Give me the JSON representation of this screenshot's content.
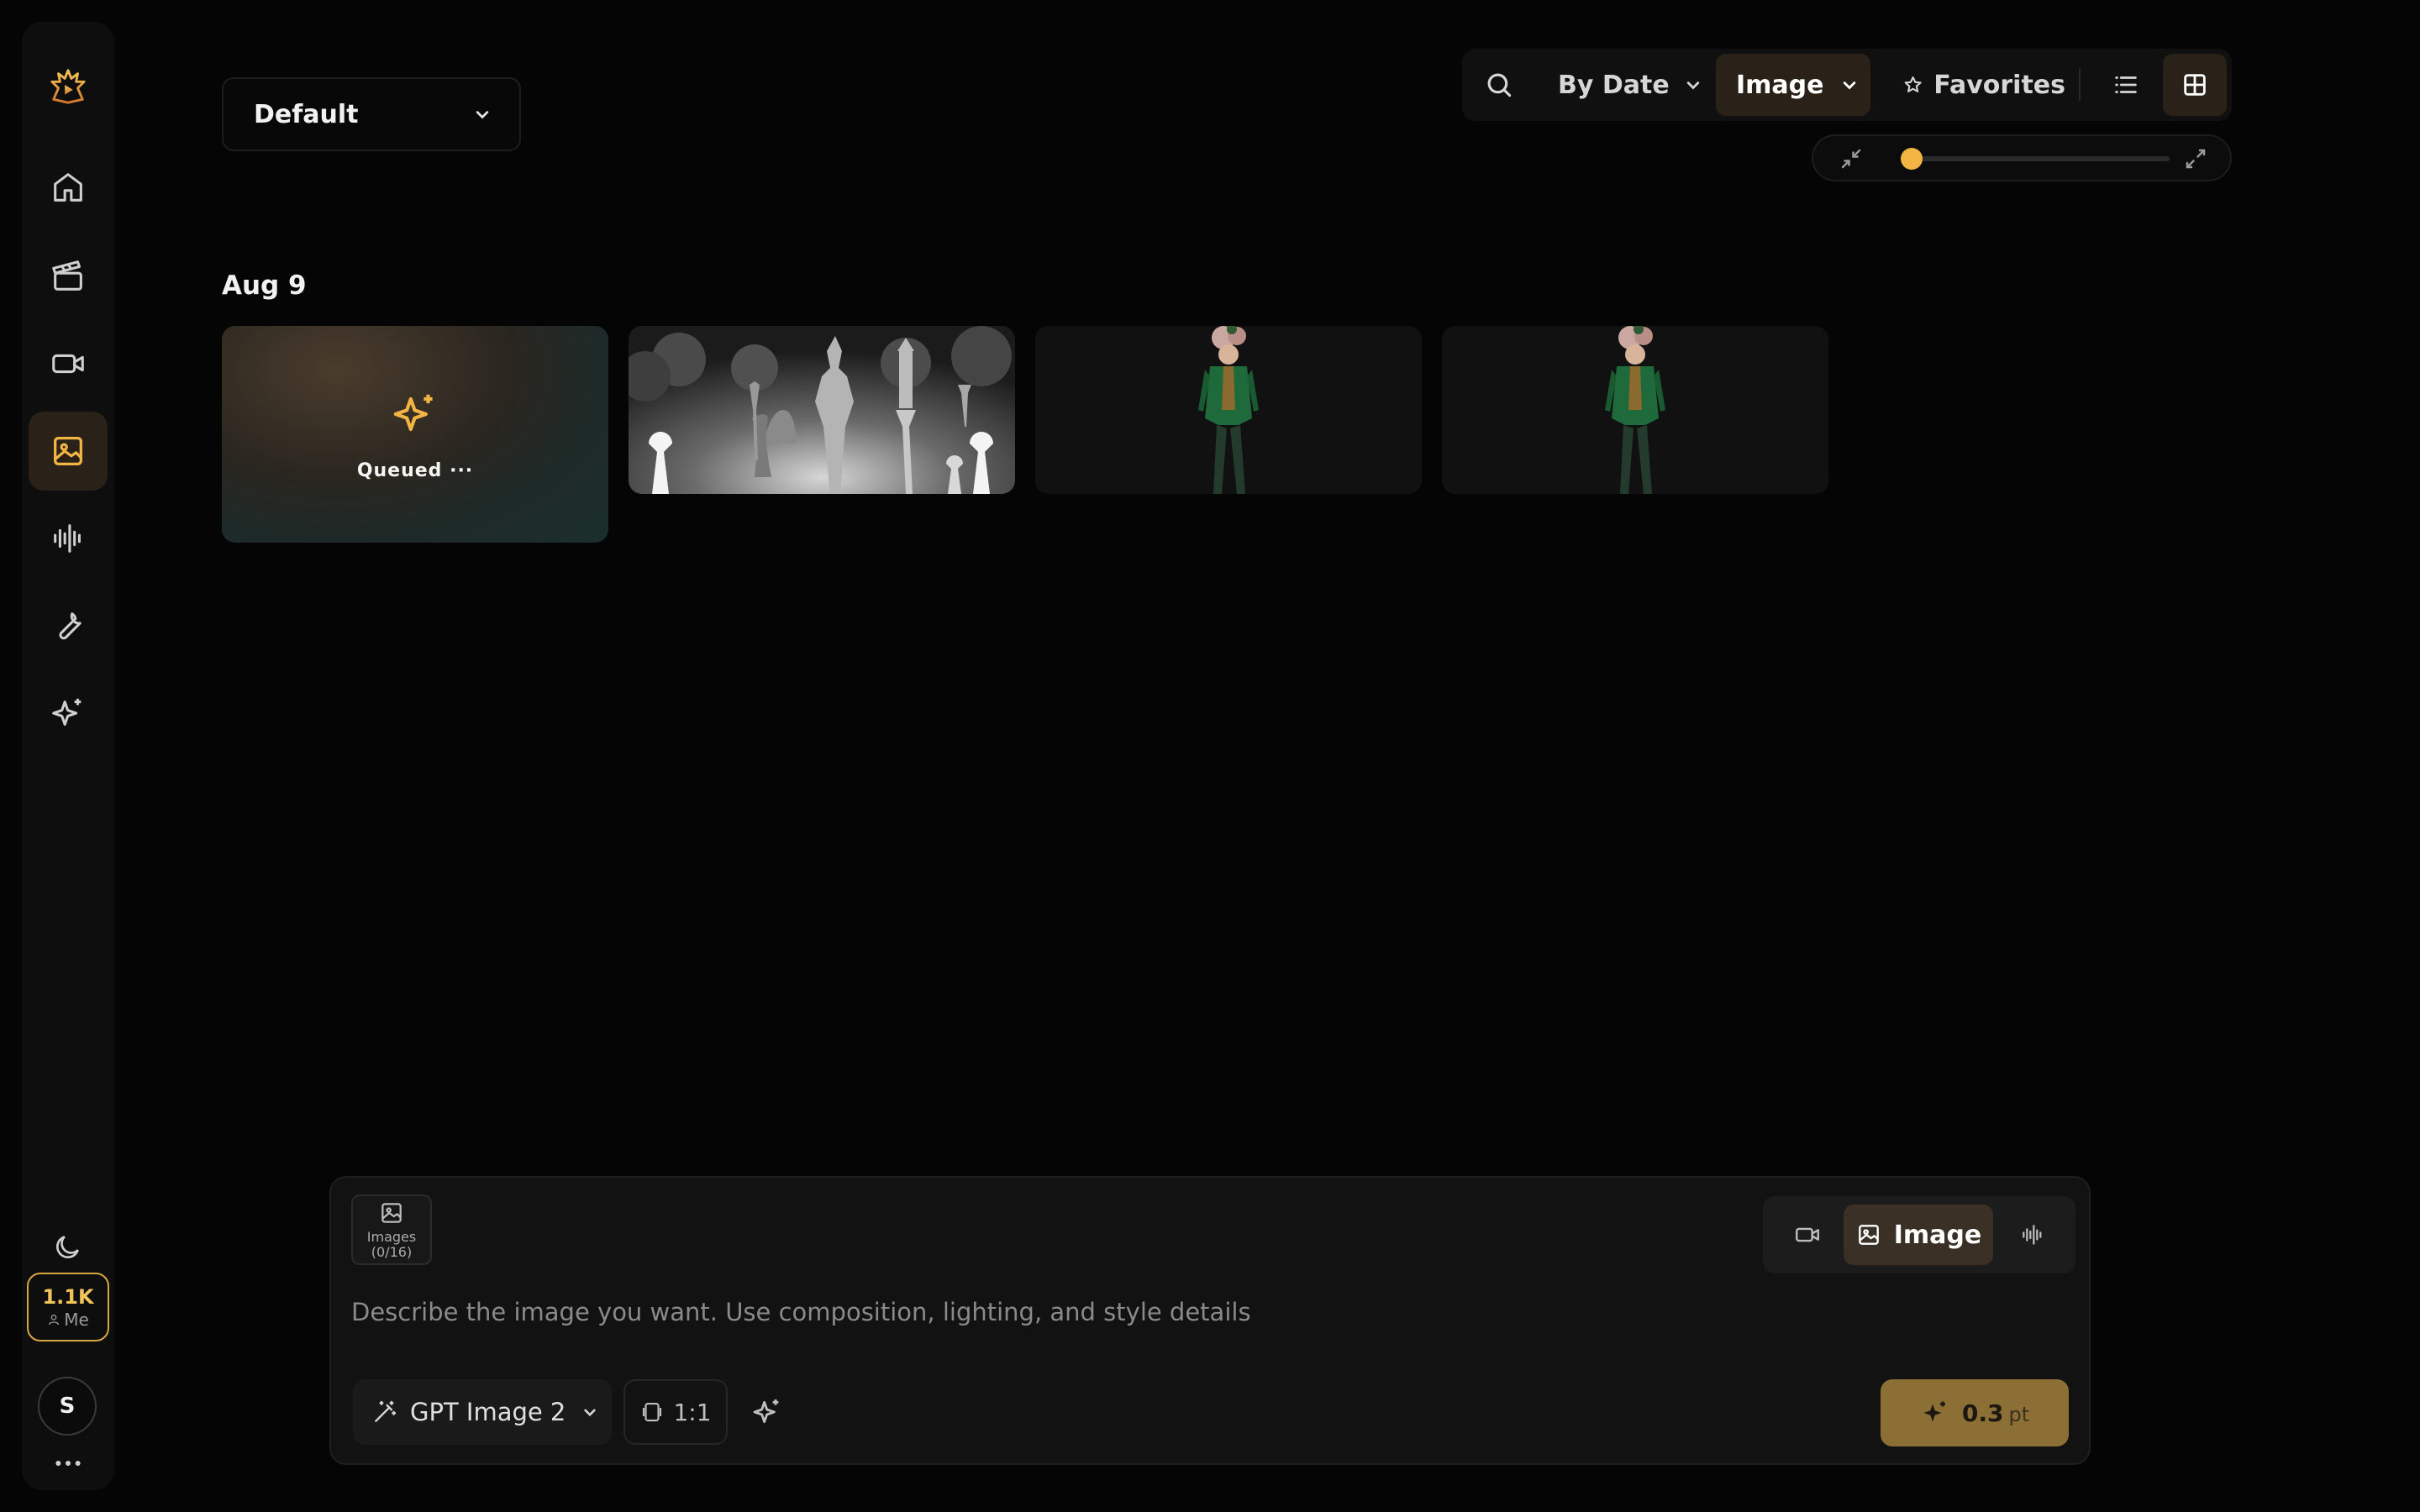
{
  "sidebar": {
    "items": [
      {
        "name": "logo",
        "icon": "logo-icon"
      },
      {
        "name": "home",
        "icon": "home-icon"
      },
      {
        "name": "storyboard",
        "icon": "clapperboard-icon"
      },
      {
        "name": "video",
        "icon": "video-icon"
      },
      {
        "name": "image",
        "icon": "image-icon",
        "active": true
      },
      {
        "name": "audio",
        "icon": "audio-waveform-icon"
      },
      {
        "name": "tools",
        "icon": "wrench-icon"
      },
      {
        "name": "magic",
        "icon": "sparkles-icon"
      }
    ],
    "theme_icon": "moon-icon",
    "credits": {
      "amount": "1.1K",
      "owner": "Me"
    },
    "avatar_initial": "S",
    "more_icon": "more-horizontal-icon"
  },
  "header": {
    "folder": {
      "selected": "Default"
    },
    "toolbar": {
      "sort_label": "By Date",
      "type_label": "Image",
      "favorites_label": "Favorites",
      "view_mode": "grid"
    },
    "zoom": {
      "level": 0.04
    }
  },
  "gallery": {
    "groups": [
      {
        "date": "Aug 9",
        "items": [
          {
            "status": "Queued ···",
            "kind": "queued"
          },
          {
            "kind": "image",
            "alt": "chess-figure-depth-map"
          },
          {
            "kind": "image",
            "alt": "green-jacket-character"
          },
          {
            "kind": "image",
            "alt": "green-jacket-character"
          }
        ]
      }
    ]
  },
  "composer": {
    "upload": {
      "label": "Images",
      "count": "(0/16)"
    },
    "modes": [
      "Video",
      "Image",
      "Audio"
    ],
    "active_mode": "Image",
    "prompt_placeholder": "Describe the image you want. Use composition, lighting, and style details",
    "model": "GPT Image 2",
    "aspect_ratio": "1:1",
    "cost": {
      "value": "0.3",
      "unit": "pt"
    }
  },
  "colors": {
    "accent": "#f2b544",
    "active_bg": "#2a2219",
    "background": "#050505",
    "generate_button": "#8c6f35"
  }
}
